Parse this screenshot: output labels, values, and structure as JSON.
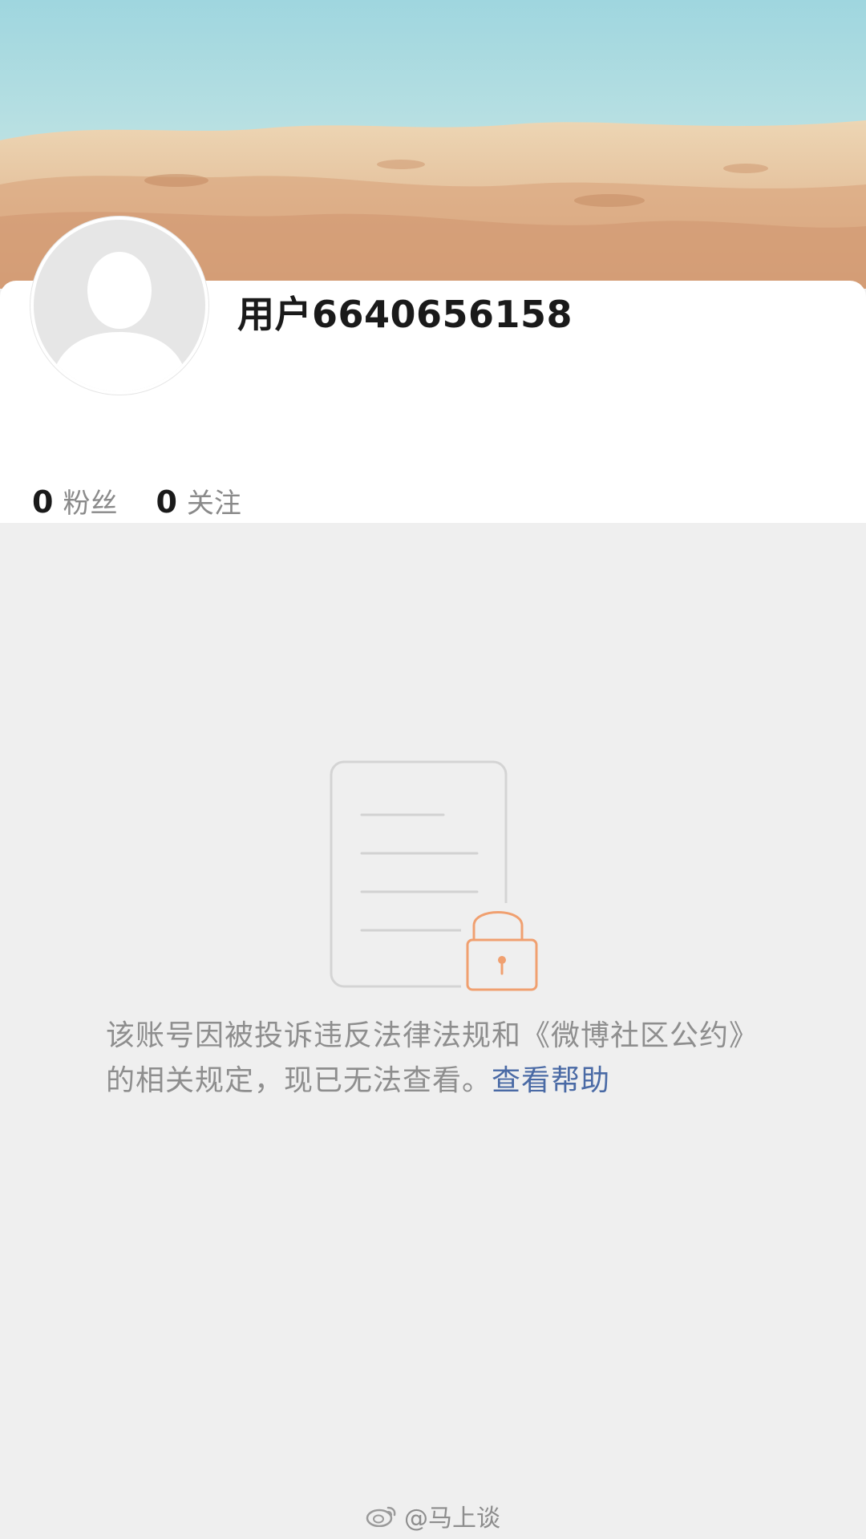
{
  "profile": {
    "username": "用户6640656158",
    "followers_count": "0",
    "followers_label": "粉丝",
    "following_count": "0",
    "following_label": "关注"
  },
  "notice": {
    "text": "该账号因被投诉违反法律法规和《微博社区公约》的相关规定，现已无法查看。",
    "help_link": "查看帮助"
  },
  "watermark": {
    "text": "@马上谈"
  },
  "colors": {
    "page_background": "#efefef",
    "card_background": "#ffffff",
    "link": "#4a6aa5",
    "lock_accent": "#f0a070"
  }
}
